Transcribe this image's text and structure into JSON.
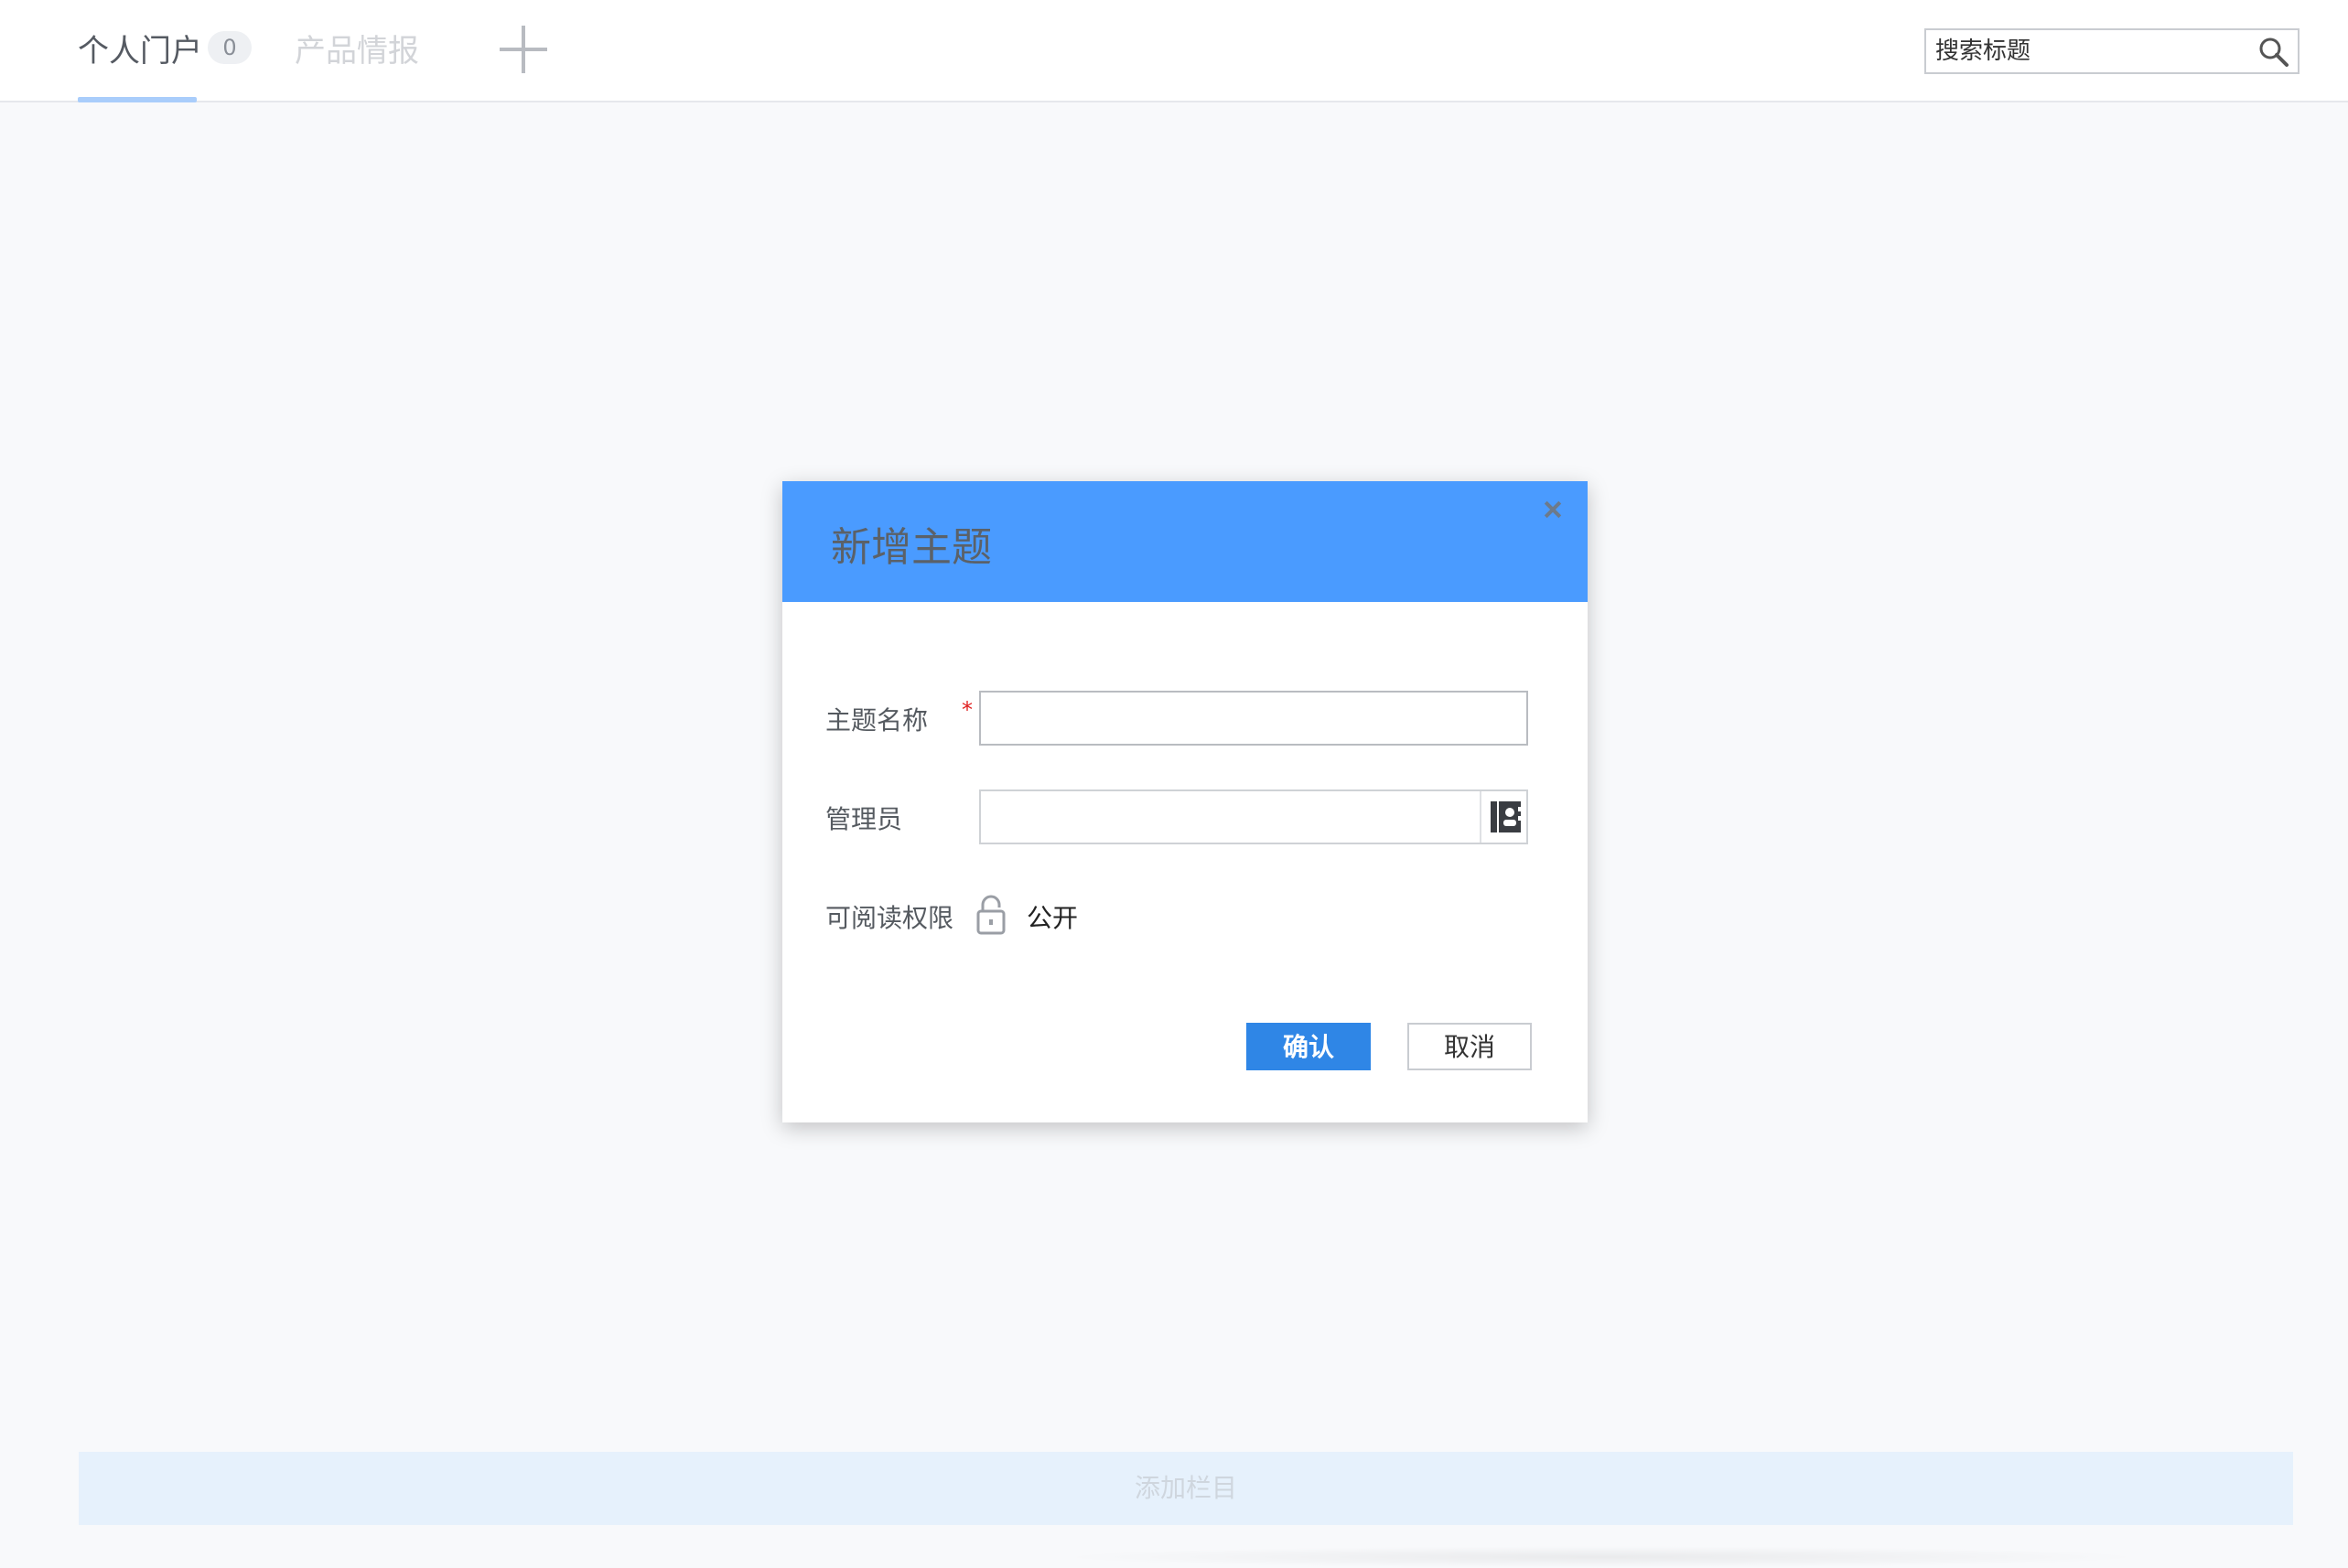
{
  "tabs": {
    "personal": {
      "label": "个人门户",
      "badge": "0"
    },
    "product": {
      "label": "产品情报"
    }
  },
  "search": {
    "placeholder": "搜索标题"
  },
  "modal": {
    "title": "新增主题",
    "fields": {
      "name_label": "主题名称",
      "required_mark": "*",
      "admin_label": "管理员",
      "permission_label": "可阅读权限",
      "permission_value": "公开"
    },
    "confirm_label": "确认",
    "cancel_label": "取消"
  },
  "add_column_label": "添加栏目",
  "colors": {
    "header_blue": "#4a9bff",
    "confirm_blue": "#2f86e6",
    "tab_underline": "#a9cdfb",
    "add_bar_bg": "#e6f1fc"
  },
  "icons": [
    "plus-icon",
    "search-icon",
    "close-icon",
    "contacts-icon",
    "lock-icon"
  ]
}
